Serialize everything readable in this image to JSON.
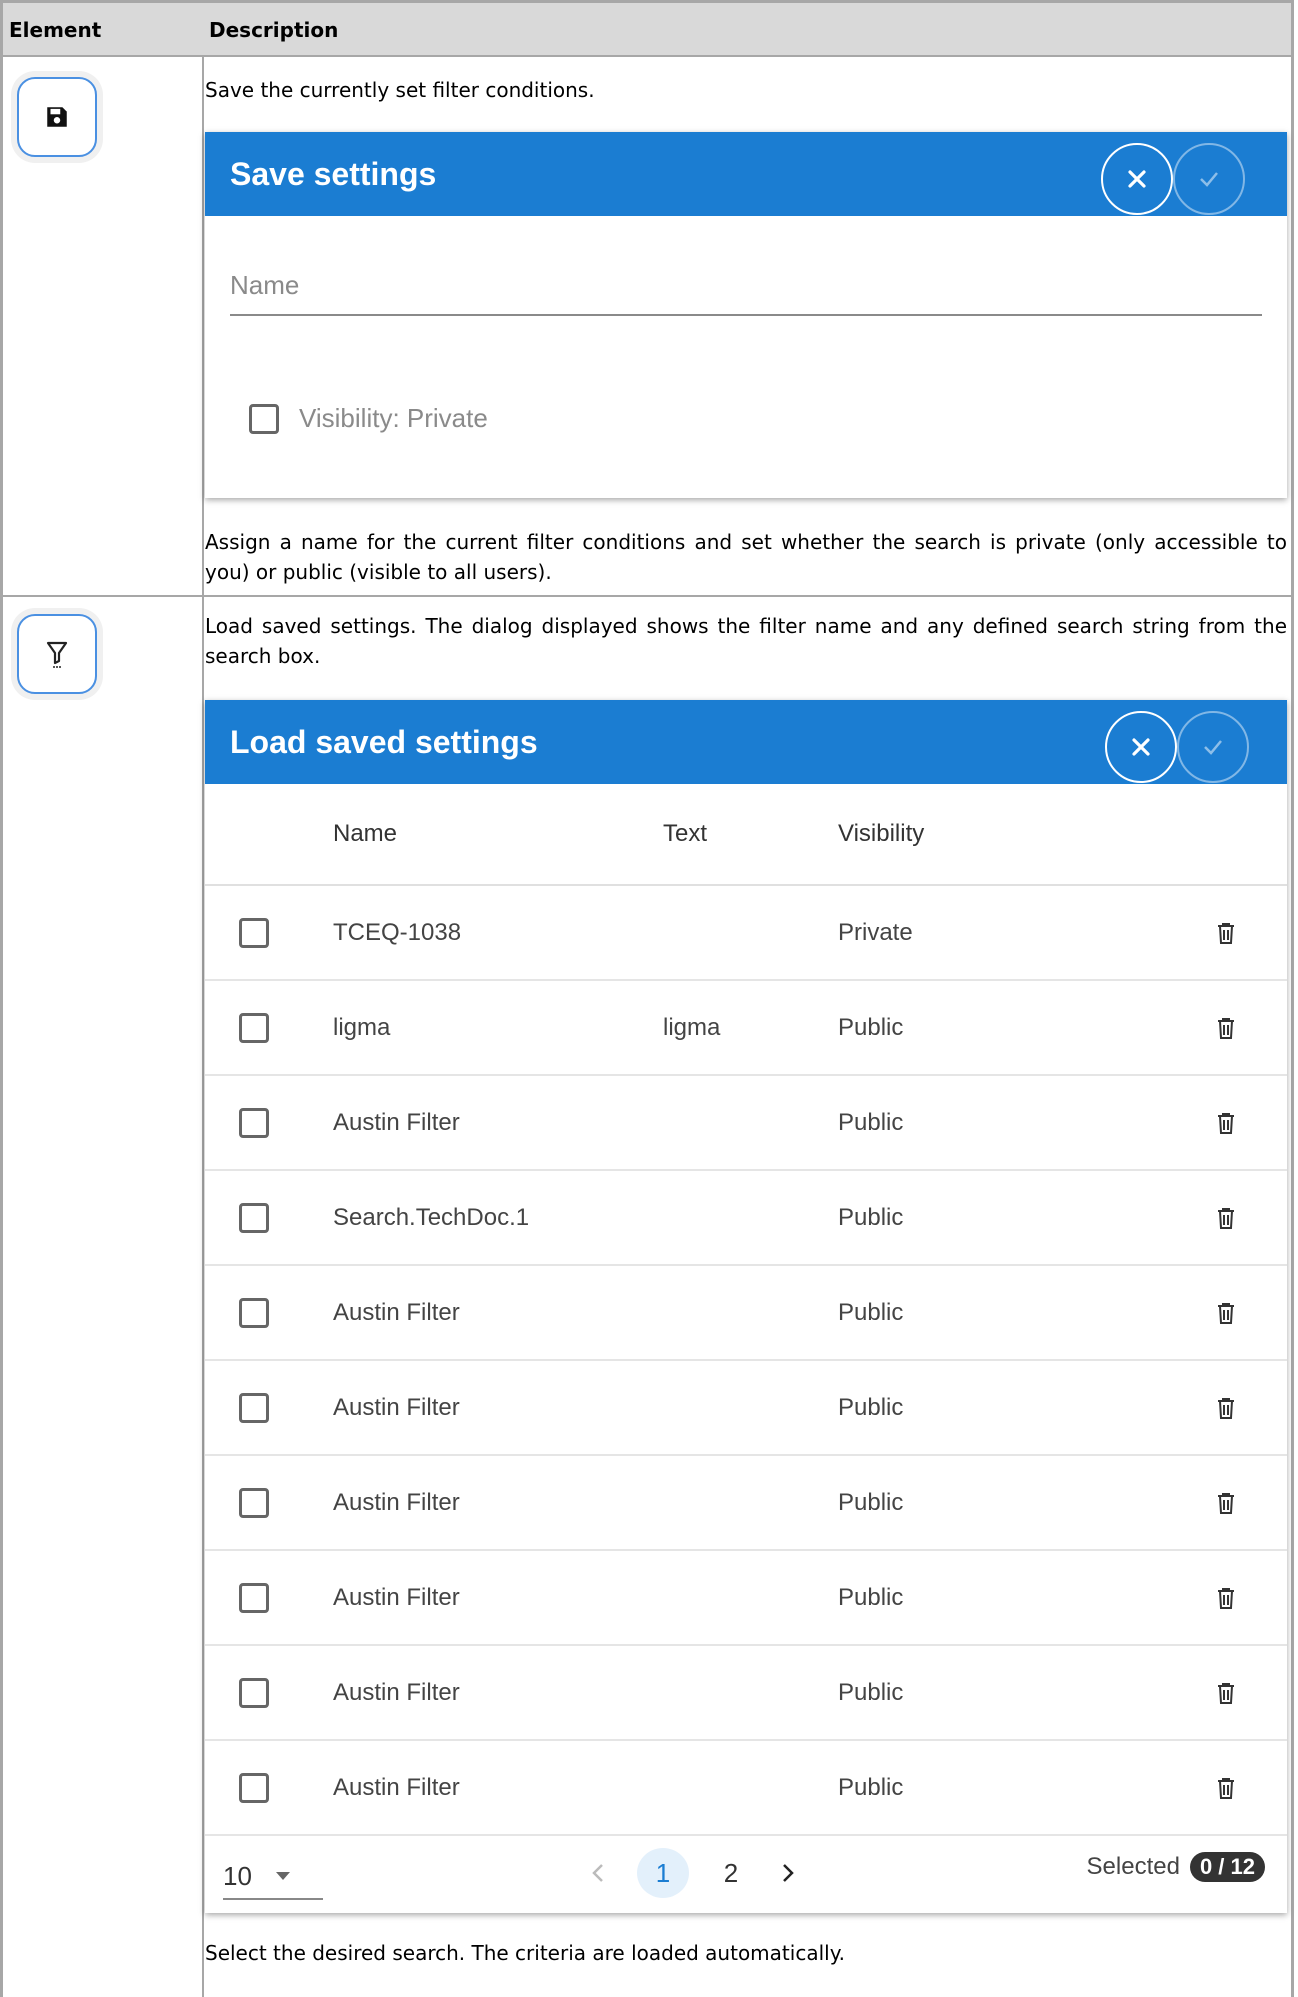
{
  "table": {
    "header": {
      "element": "Element",
      "description": "Description"
    }
  },
  "rows": {
    "save": {
      "icon": "floppy-disk-icon",
      "description": "Save the currently set filter conditions.",
      "note": "Assign a name for the current filter conditions and set whether the search is private (only accessible to you) or public (visible to all users).",
      "dialog": {
        "title": "Save settings",
        "name_placeholder": "Name",
        "visibility_label": "Visibility: Private"
      }
    },
    "load": {
      "icon": "filter-icon",
      "description": "Load saved settings. The dialog displayed shows the filter name and any defined search string from the search box.",
      "note": "Select the desired search. The criteria are loaded automatically.",
      "dialog": {
        "title": "Load saved settings",
        "columns": {
          "name": "Name",
          "text": "Text",
          "visibility": "Visibility"
        },
        "rows": [
          {
            "name": "TCEQ-1038",
            "text": "",
            "visibility": "Private"
          },
          {
            "name": "ligma",
            "text": "ligma",
            "visibility": "Public"
          },
          {
            "name": "Austin Filter",
            "text": "",
            "visibility": "Public"
          },
          {
            "name": "Search.TechDoc.1",
            "text": "",
            "visibility": "Public"
          },
          {
            "name": "Austin Filter",
            "text": "",
            "visibility": "Public"
          },
          {
            "name": "Austin Filter",
            "text": "",
            "visibility": "Public"
          },
          {
            "name": "Austin Filter",
            "text": "",
            "visibility": "Public"
          },
          {
            "name": "Austin Filter",
            "text": "",
            "visibility": "Public"
          },
          {
            "name": "Austin Filter",
            "text": "",
            "visibility": "Public"
          },
          {
            "name": "Austin Filter",
            "text": "",
            "visibility": "Public"
          }
        ],
        "pagination": {
          "per_page": "10",
          "pages": [
            "1",
            "2"
          ],
          "current_page": "1",
          "selected_label": "Selected",
          "selected_count": "0 / 12"
        }
      }
    }
  },
  "colors": {
    "header_bg": "#d9d9d9",
    "dialog_header": "#1b7dd2",
    "button_border": "#4a90e2"
  }
}
